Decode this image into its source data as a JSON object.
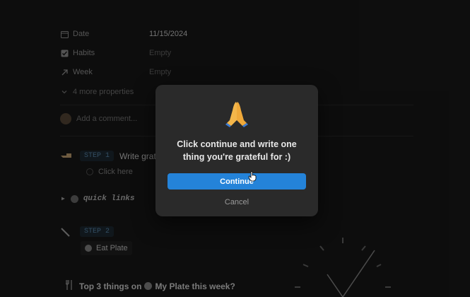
{
  "properties": [
    {
      "icon": "calendar-icon",
      "name": "Date",
      "value": "11/15/2024",
      "empty": false
    },
    {
      "icon": "checkbox-icon",
      "name": "Habits",
      "value": "Empty",
      "empty": true
    },
    {
      "icon": "arrow-up-right-icon",
      "name": "Week",
      "value": "Empty",
      "empty": true
    }
  ],
  "more_properties": "4 more properties",
  "comment_placeholder": "Add a comment...",
  "step1": {
    "tag": "STEP 1",
    "text": "Write grati",
    "sub": "Click here"
  },
  "quick_links": "quick links",
  "step2": {
    "tag": "STEP 2",
    "chip": "Eat Plate"
  },
  "top3": {
    "before": "Top 3 things on",
    "after": "My Plate this week?"
  },
  "modal": {
    "emoji": "🙏",
    "message": "Click continue and write one thing you're grateful for :)",
    "continue_label": "Continue",
    "cancel_label": "Cancel"
  },
  "colors": {
    "accent": "#2483d9",
    "modal_bg": "#2a2a2a",
    "page_bg": "#191919"
  }
}
